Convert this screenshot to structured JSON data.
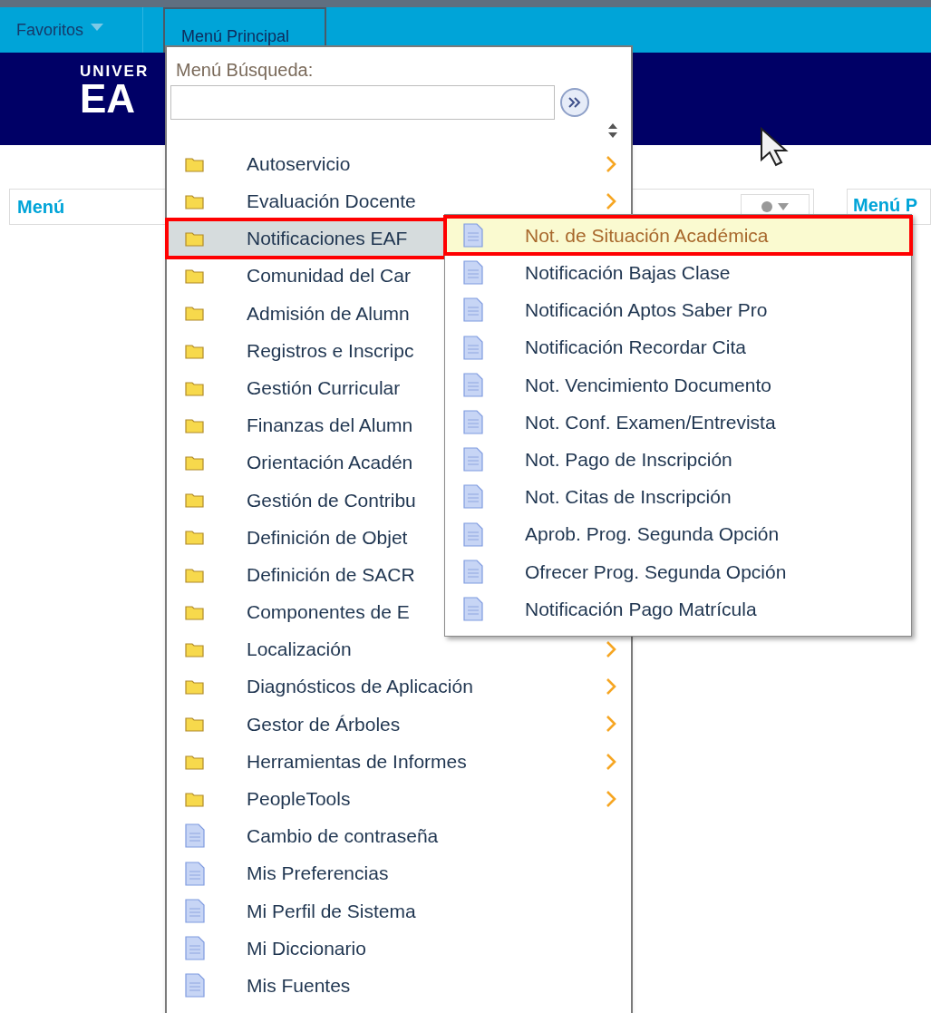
{
  "nav": {
    "favorites": "Favoritos",
    "main_menu": "Menú Principal"
  },
  "banner": {
    "logo_top": "UNIVER",
    "logo_main": "EA"
  },
  "content": {
    "left_title": "Menú",
    "right_title": "Menú P"
  },
  "dropdown": {
    "search_label": "Menú Búsqueda:",
    "items": [
      {
        "label": "Autoservicio",
        "kind": "folder",
        "selected": false,
        "submenu_arrow": true
      },
      {
        "label": "Evaluación Docente",
        "kind": "folder",
        "selected": false,
        "submenu_arrow": true
      },
      {
        "label": "Notificaciones EAF",
        "kind": "folder",
        "selected": true,
        "submenu_arrow": false
      },
      {
        "label": "Comunidad del Car",
        "kind": "folder",
        "selected": false,
        "submenu_arrow": false
      },
      {
        "label": "Admisión de Alumn",
        "kind": "folder",
        "selected": false,
        "submenu_arrow": false
      },
      {
        "label": "Registros e Inscripc",
        "kind": "folder",
        "selected": false,
        "submenu_arrow": false
      },
      {
        "label": "Gestión Curricular",
        "kind": "folder",
        "selected": false,
        "submenu_arrow": false
      },
      {
        "label": "Finanzas del Alumn",
        "kind": "folder",
        "selected": false,
        "submenu_arrow": false
      },
      {
        "label": "Orientación Acadén",
        "kind": "folder",
        "selected": false,
        "submenu_arrow": false
      },
      {
        "label": "Gestión de Contribu",
        "kind": "folder",
        "selected": false,
        "submenu_arrow": false
      },
      {
        "label": "Definición de Objet",
        "kind": "folder",
        "selected": false,
        "submenu_arrow": false
      },
      {
        "label": "Definición de SACR",
        "kind": "folder",
        "selected": false,
        "submenu_arrow": false
      },
      {
        "label": "Componentes de E",
        "kind": "folder",
        "selected": false,
        "submenu_arrow": false
      },
      {
        "label": "Localización",
        "kind": "folder",
        "selected": false,
        "submenu_arrow": true
      },
      {
        "label": "Diagnósticos de Aplicación",
        "kind": "folder",
        "selected": false,
        "submenu_arrow": true
      },
      {
        "label": "Gestor de Árboles",
        "kind": "folder",
        "selected": false,
        "submenu_arrow": true
      },
      {
        "label": "Herramientas de Informes",
        "kind": "folder",
        "selected": false,
        "submenu_arrow": true
      },
      {
        "label": "PeopleTools",
        "kind": "folder",
        "selected": false,
        "submenu_arrow": true
      },
      {
        "label": "Cambio de contraseña",
        "kind": "page",
        "selected": false,
        "submenu_arrow": false
      },
      {
        "label": "Mis Preferencias",
        "kind": "page",
        "selected": false,
        "submenu_arrow": false
      },
      {
        "label": "Mi Perfil de Sistema",
        "kind": "page",
        "selected": false,
        "submenu_arrow": false
      },
      {
        "label": "Mi Diccionario",
        "kind": "page",
        "selected": false,
        "submenu_arrow": false
      },
      {
        "label": "Mis Fuentes",
        "kind": "page",
        "selected": false,
        "submenu_arrow": false
      }
    ]
  },
  "submenu": {
    "items": [
      {
        "label": "Not. de Situación Académica",
        "selected": true
      },
      {
        "label": "Notificación Bajas Clase",
        "selected": false
      },
      {
        "label": "Notificación Aptos Saber Pro",
        "selected": false
      },
      {
        "label": "Notificación Recordar Cita",
        "selected": false
      },
      {
        "label": "Not. Vencimiento Documento",
        "selected": false
      },
      {
        "label": "Not. Conf. Examen/Entrevista",
        "selected": false
      },
      {
        "label": "Not. Pago de Inscripción",
        "selected": false
      },
      {
        "label": "Not. Citas de Inscripción",
        "selected": false
      },
      {
        "label": "Aprob. Prog. Segunda Opción",
        "selected": false
      },
      {
        "label": "Ofrecer Prog. Segunda Opción",
        "selected": false
      },
      {
        "label": "Notificación Pago Matrícula",
        "selected": false
      }
    ]
  }
}
